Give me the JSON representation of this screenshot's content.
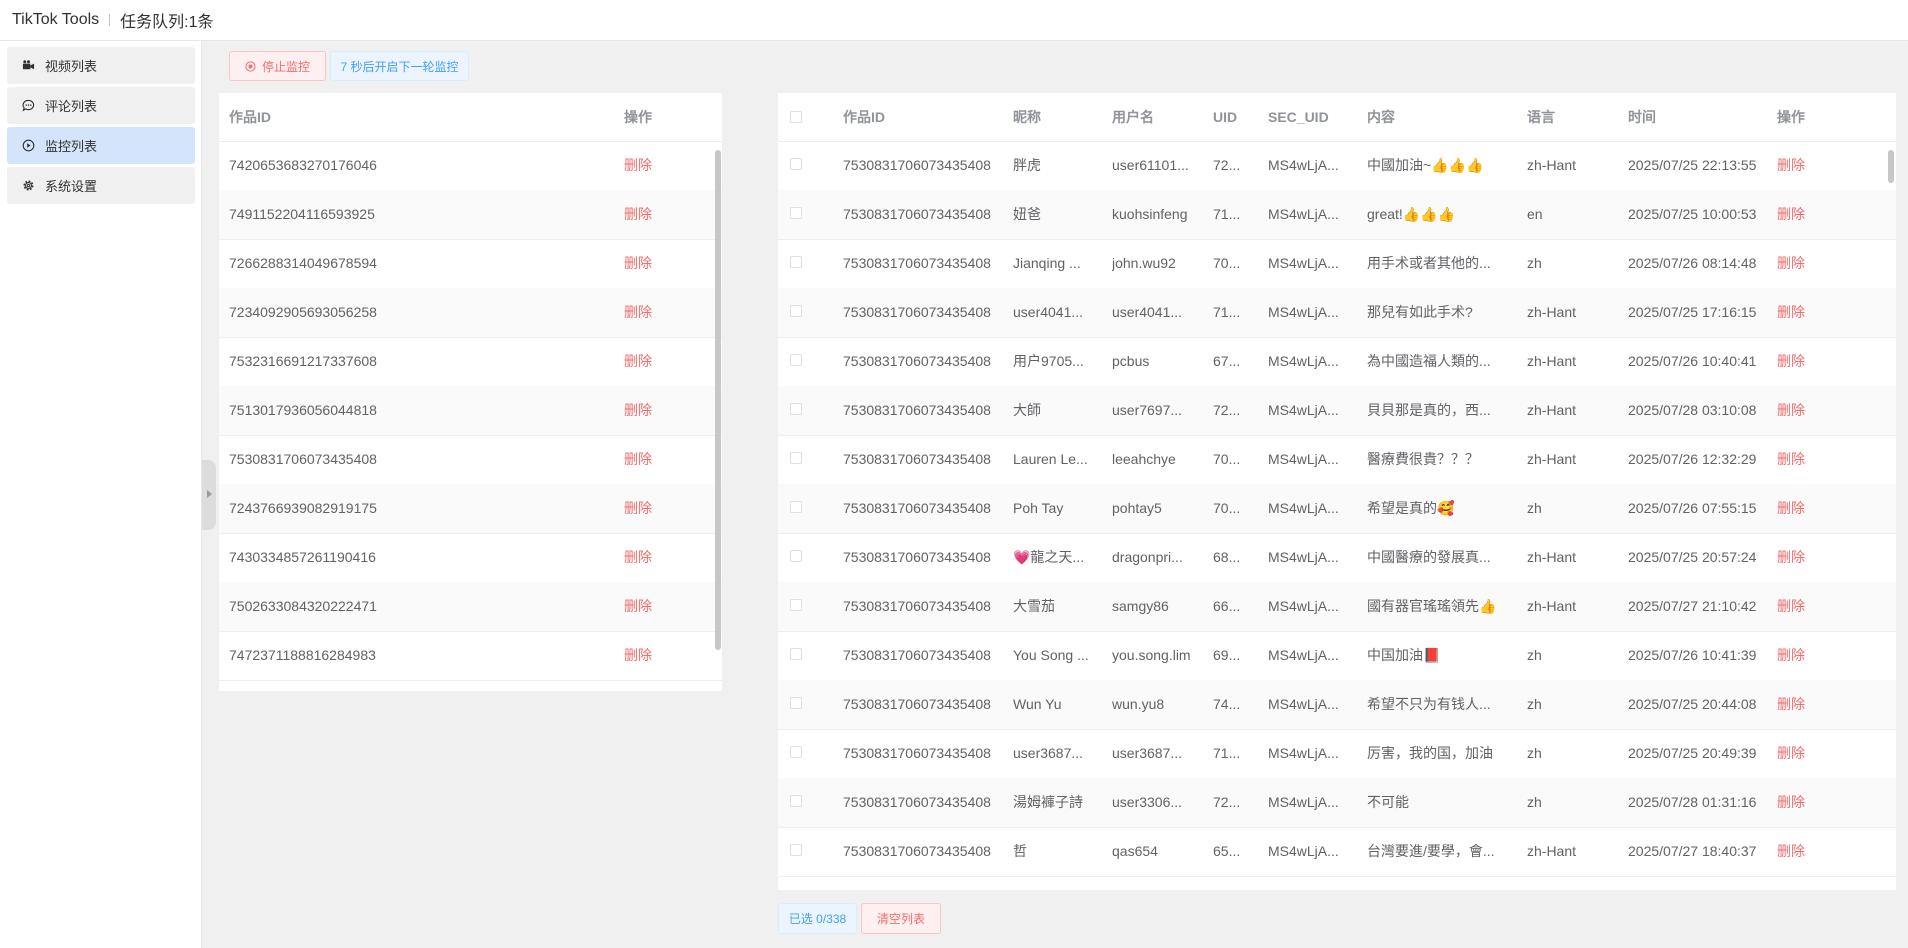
{
  "header": {
    "app_title": "TikTok Tools",
    "queue": "任务队列:1条"
  },
  "sidebar": {
    "items": [
      {
        "label": "视频列表",
        "icon": "video-icon",
        "active": false
      },
      {
        "label": "评论列表",
        "icon": "comment-icon",
        "active": false
      },
      {
        "label": "监控列表",
        "icon": "play-circle-icon",
        "active": true
      },
      {
        "label": "系统设置",
        "icon": "gear-icon",
        "active": false
      }
    ]
  },
  "toolbar": {
    "stop_label": "停止监控",
    "countdown_label": "7 秒后开启下一轮监控"
  },
  "left_table": {
    "headers": {
      "id": "作品ID",
      "op": "操作"
    },
    "rows": [
      {
        "id": "7420653683270176046",
        "op": "删除"
      },
      {
        "id": "7491152204116593925",
        "op": "删除"
      },
      {
        "id": "7266288314049678594",
        "op": "删除"
      },
      {
        "id": "7234092905693056258",
        "op": "删除"
      },
      {
        "id": "7532316691217337608",
        "op": "删除"
      },
      {
        "id": "7513017936056044818",
        "op": "删除"
      },
      {
        "id": "7530831706073435408",
        "op": "删除"
      },
      {
        "id": "7243766939082919175",
        "op": "删除"
      },
      {
        "id": "7430334857261190416",
        "op": "删除"
      },
      {
        "id": "7502633084320222471",
        "op": "删除"
      },
      {
        "id": "7472371188816284983",
        "op": "删除"
      }
    ]
  },
  "right_table": {
    "headers": {
      "id": "作品ID",
      "nickname": "昵称",
      "username": "用户名",
      "uid": "UID",
      "sec_uid": "SEC_UID",
      "content": "内容",
      "lang": "语言",
      "time": "时间",
      "op": "操作"
    },
    "rows": [
      {
        "id": "7530831706073435408",
        "nickname": "胖虎",
        "username": "user61101...",
        "uid": "72...",
        "sec_uid": "MS4wLjA...",
        "content": "中國加油~👍👍👍",
        "lang": "zh-Hant",
        "time": "2025/07/25 22:13:55",
        "op": "删除"
      },
      {
        "id": "7530831706073435408",
        "nickname": "妞爸",
        "username": "kuohsinfeng",
        "uid": "71...",
        "sec_uid": "MS4wLjA...",
        "content": "great!👍👍👍",
        "lang": "en",
        "time": "2025/07/25 10:00:53",
        "op": "删除"
      },
      {
        "id": "7530831706073435408",
        "nickname": "Jianqing ...",
        "username": "john.wu92",
        "uid": "70...",
        "sec_uid": "MS4wLjA...",
        "content": "用手术或者其他的...",
        "lang": "zh",
        "time": "2025/07/26 08:14:48",
        "op": "删除"
      },
      {
        "id": "7530831706073435408",
        "nickname": "user4041...",
        "username": "user4041...",
        "uid": "71...",
        "sec_uid": "MS4wLjA...",
        "content": "那兒有如此手术?",
        "lang": "zh-Hant",
        "time": "2025/07/25 17:16:15",
        "op": "删除"
      },
      {
        "id": "7530831706073435408",
        "nickname": "用户9705...",
        "username": "pcbus",
        "uid": "67...",
        "sec_uid": "MS4wLjA...",
        "content": "為中國造福人類的...",
        "lang": "zh-Hant",
        "time": "2025/07/26 10:40:41",
        "op": "删除"
      },
      {
        "id": "7530831706073435408",
        "nickname": "大師",
        "username": "user7697...",
        "uid": "72...",
        "sec_uid": "MS4wLjA...",
        "content": "貝貝那是真的，西...",
        "lang": "zh-Hant",
        "time": "2025/07/28 03:10:08",
        "op": "删除"
      },
      {
        "id": "7530831706073435408",
        "nickname": "Lauren Le...",
        "username": "leeahchye",
        "uid": "70...",
        "sec_uid": "MS4wLjA...",
        "content": "醫療費很貴？？？",
        "lang": "zh-Hant",
        "time": "2025/07/26 12:32:29",
        "op": "删除"
      },
      {
        "id": "7530831706073435408",
        "nickname": "Poh Tay",
        "username": "pohtay5",
        "uid": "70...",
        "sec_uid": "MS4wLjA...",
        "content": "希望是真的🥰",
        "lang": "zh",
        "time": "2025/07/26 07:55:15",
        "op": "删除"
      },
      {
        "id": "7530831706073435408",
        "nickname": "💗龍之天...",
        "username": "dragonpri...",
        "uid": "68...",
        "sec_uid": "MS4wLjA...",
        "content": "中國醫療的發展真...",
        "lang": "zh-Hant",
        "time": "2025/07/25 20:57:24",
        "op": "删除"
      },
      {
        "id": "7530831706073435408",
        "nickname": "大雪茄",
        "username": "samgy86",
        "uid": "66...",
        "sec_uid": "MS4wLjA...",
        "content": "國有器官瑤瑤領先👍",
        "lang": "zh-Hant",
        "time": "2025/07/27 21:10:42",
        "op": "删除"
      },
      {
        "id": "7530831706073435408",
        "nickname": "You Song ...",
        "username": "you.song.lim",
        "uid": "69...",
        "sec_uid": "MS4wLjA...",
        "content": "中国加油📕",
        "lang": "zh",
        "time": "2025/07/26 10:41:39",
        "op": "删除"
      },
      {
        "id": "7530831706073435408",
        "nickname": "Wun Yu",
        "username": "wun.yu8",
        "uid": "74...",
        "sec_uid": "MS4wLjA...",
        "content": "希望不只为有钱人...",
        "lang": "zh",
        "time": "2025/07/25 20:44:08",
        "op": "删除"
      },
      {
        "id": "7530831706073435408",
        "nickname": "user3687...",
        "username": "user3687...",
        "uid": "71...",
        "sec_uid": "MS4wLjA...",
        "content": "厉害，我的国，加油",
        "lang": "zh",
        "time": "2025/07/25 20:49:39",
        "op": "删除"
      },
      {
        "id": "7530831706073435408",
        "nickname": "湯姆褲子詩",
        "username": "user3306...",
        "uid": "72...",
        "sec_uid": "MS4wLjA...",
        "content": "不可能",
        "lang": "zh",
        "time": "2025/07/28 01:31:16",
        "op": "删除"
      },
      {
        "id": "7530831706073435408",
        "nickname": "哲",
        "username": "qas654",
        "uid": "65...",
        "sec_uid": "MS4wLjA...",
        "content": "台灣要進/要學，會...",
        "lang": "zh-Hant",
        "time": "2025/07/27 18:40:37",
        "op": "删除"
      }
    ]
  },
  "footer": {
    "selected_label": "已选 0/338",
    "clear_label": "清空列表"
  },
  "colors": {
    "danger": "#f56c6c",
    "primary": "#409eff",
    "active_menu": "#d4e5fb"
  }
}
